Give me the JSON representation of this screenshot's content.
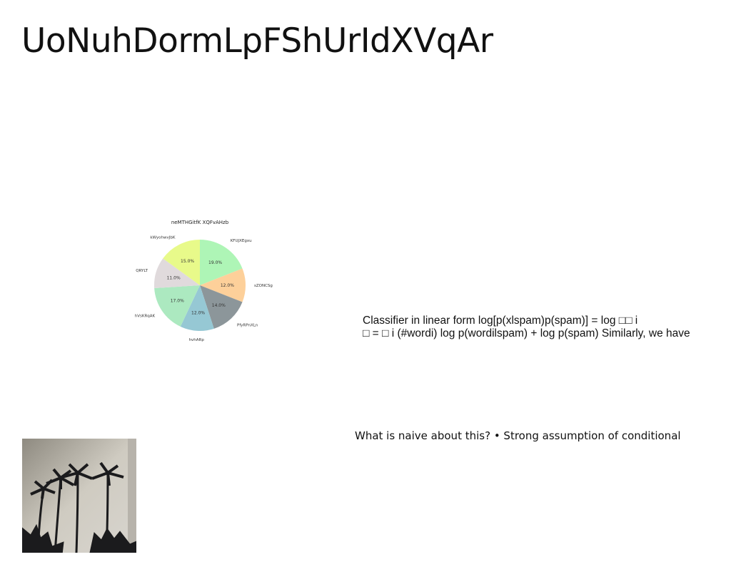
{
  "slide": {
    "title": "UoNuhDormLpFShUrIdXVqAr",
    "formula_lines": [
      "Classifier in linear form log[p(xlspam)p(spam)] = log □□ i",
      "□ = □ i (#wordi) log p(wordilspam) + log p(spam) Similarly, we have"
    ],
    "naive_text": "What is naive about this? • Strong assumption of conditional",
    "photo_icon": "palm-trees-photo"
  },
  "chart_data": {
    "type": "pie",
    "title": "neMTHGitfK XQFvAHzb",
    "slices": [
      {
        "label": "KFUJXEgxu",
        "value": 19.0,
        "color": "#aef5b6"
      },
      {
        "label": "sZONCSg",
        "value": 12.0,
        "color": "#fdd09a"
      },
      {
        "label": "PfyRPnXLn",
        "value": 14.0,
        "color": "#8c969a"
      },
      {
        "label": "hvhARp",
        "value": 12.0,
        "color": "#96c8d4"
      },
      {
        "label": "hVsKRqAK",
        "value": 17.0,
        "color": "#ace9c0"
      },
      {
        "label": "QRYLT",
        "value": 11.0,
        "color": "#e0dadc"
      },
      {
        "label": "kWyohwvJbK",
        "value": 15.0,
        "color": "#e8fa8a"
      }
    ],
    "start_angle_deg": 90,
    "direction": "clockwise",
    "legend": "none"
  }
}
